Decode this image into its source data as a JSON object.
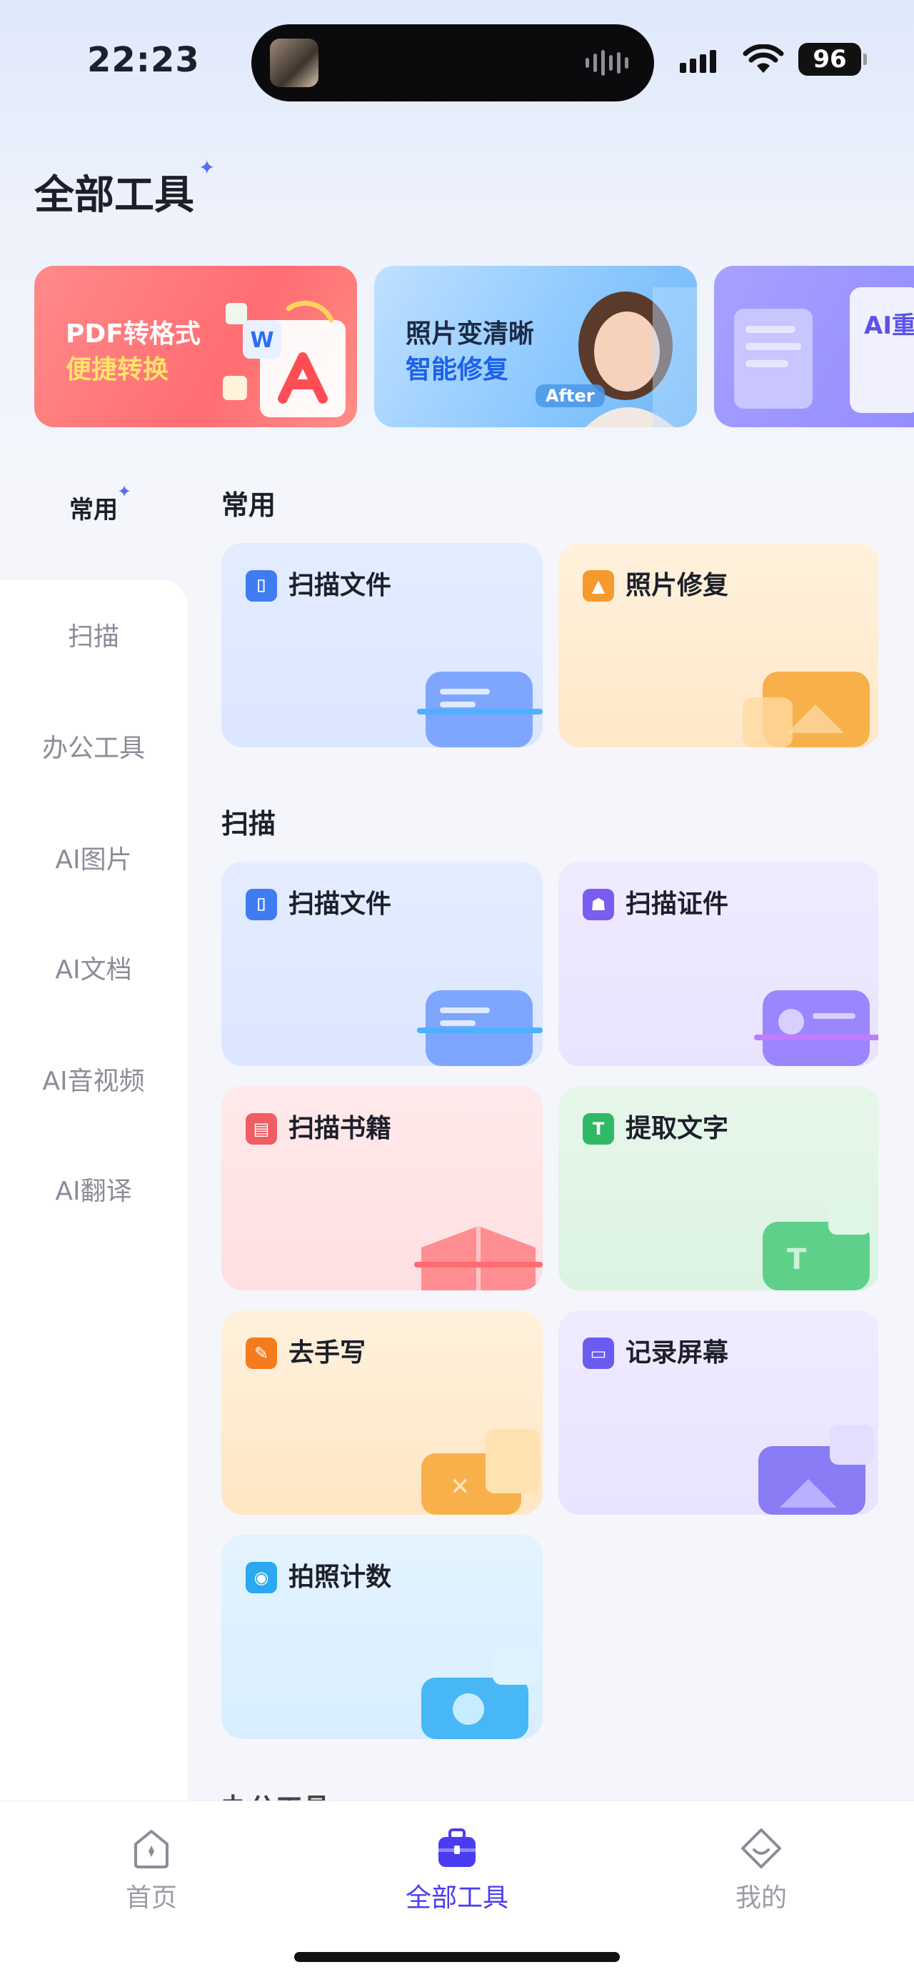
{
  "status_bar": {
    "time": "22:23",
    "battery": "96"
  },
  "page": {
    "title": "全部工具"
  },
  "banners": [
    {
      "line1": "PDF转格式",
      "line2": "便捷转换"
    },
    {
      "line1": "照片变清晰",
      "line2": "智能修复",
      "tag": "After"
    },
    {
      "label": "AI重"
    }
  ],
  "sidebar": {
    "items": [
      "常用",
      "扫描",
      "办公工具",
      "AI图片",
      "AI文档",
      "AI音视频",
      "AI翻译"
    ],
    "active": "常用"
  },
  "sections": [
    {
      "title": "常用",
      "tools": [
        {
          "label": "扫描文件",
          "icon": "scan-frame-icon",
          "color": "#3f7cf2"
        },
        {
          "label": "照片修复",
          "icon": "photo-repair-icon",
          "color": "#f59a2e"
        }
      ]
    },
    {
      "title": "扫描",
      "tools": [
        {
          "label": "扫描文件",
          "icon": "scan-frame-icon",
          "color": "#3f7cf2"
        },
        {
          "label": "扫描证件",
          "icon": "id-card-icon",
          "color": "#7a5cf0"
        },
        {
          "label": "扫描书籍",
          "icon": "book-icon",
          "color": "#f05d62"
        },
        {
          "label": "提取文字",
          "icon": "text-extract-icon",
          "color": "#2fb866"
        },
        {
          "label": "去手写",
          "icon": "handwriting-erase-icon",
          "color": "#f47c1e"
        },
        {
          "label": "记录屏幕",
          "icon": "screen-record-icon",
          "color": "#6a5cf0"
        },
        {
          "label": "拍照计数",
          "icon": "photo-count-icon",
          "color": "#2aa8f0"
        }
      ]
    },
    {
      "title": "办公工具"
    }
  ],
  "tabbar": {
    "items": [
      {
        "label": "首页",
        "icon": "home-icon"
      },
      {
        "label": "全部工具",
        "icon": "toolbox-icon"
      },
      {
        "label": "我的",
        "icon": "profile-icon"
      }
    ],
    "active": "全部工具"
  },
  "colors": {
    "accent": "#4a3cf0",
    "inactive": "#9a9ca6"
  }
}
